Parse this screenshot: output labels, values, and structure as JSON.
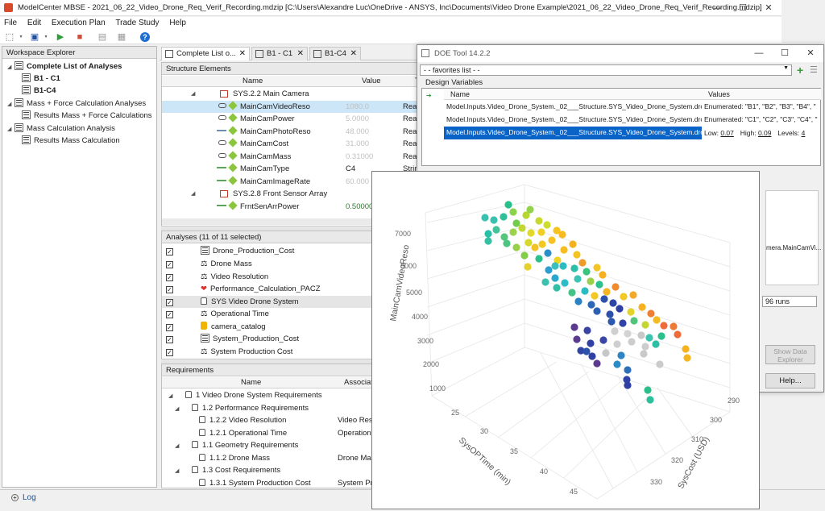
{
  "main_window": {
    "title": "ModelCenter MBSE - 2021_06_22_Video_Drone_Req_Verif_Recording.mdzip [C:\\Users\\Alexandre Luc\\OneDrive - ANSYS, Inc\\Documents\\Video Drone Example\\2021_06_22_Video_Drone_Req_Verif_Recording.mdzip]",
    "menu": [
      "File",
      "Edit",
      "Execution Plan",
      "Trade Study",
      "Help"
    ]
  },
  "workspace": {
    "header": "Workspace Explorer",
    "items": [
      {
        "label": "Complete List of Analyses",
        "bold": true
      },
      {
        "label": "B1 - C1",
        "bold": true
      },
      {
        "label": "B1-C4",
        "bold": true
      },
      {
        "label": "Mass + Force Calculation Analyses"
      },
      {
        "label": "Results Mass + Force Calculations"
      },
      {
        "label": "Mass Calculation Analysis"
      },
      {
        "label": "Results Mass Calculation"
      }
    ]
  },
  "tabs": [
    {
      "label": "Complete List o..."
    },
    {
      "label": "B1 - C1"
    },
    {
      "label": "B1-C4"
    }
  ],
  "structure": {
    "header": "Structure Elements",
    "columns": [
      "Name",
      "Value",
      "T"
    ],
    "rows": [
      {
        "name": "SYS.2.2 Main Camera",
        "value": "",
        "type": ""
      },
      {
        "name": "MainCamVideoReso",
        "value": "1080.0",
        "type": "Real"
      },
      {
        "name": "MainCamPower",
        "value": "5.0000",
        "type": "Real"
      },
      {
        "name": "MainCamPhotoReso",
        "value": "48.000",
        "type": "Real"
      },
      {
        "name": "MainCamCost",
        "value": "31.000",
        "type": "Real"
      },
      {
        "name": "MainCamMass",
        "value": "0.31000",
        "type": "Real"
      },
      {
        "name": "MainCamType",
        "value": "C4",
        "type": "Strin"
      },
      {
        "name": "MainCamImageRate",
        "value": "60.000",
        "type": "Real"
      },
      {
        "name": "SYS.2.8 Front Sensor Array",
        "value": "",
        "type": ""
      },
      {
        "name": "FrntSenArrPower",
        "value": "0.50000",
        "type": ""
      }
    ]
  },
  "analyses": {
    "header": "Analyses (11 of 11 selected)",
    "items": [
      "Drone_Production_Cost",
      "Drone Mass",
      "Video Resolution",
      "Performance_Calculation_PACZ",
      "SYS Video Drone System",
      "Operational Time",
      "camera_catalog",
      "System_Production_Cost",
      "System Production Cost"
    ]
  },
  "requirements": {
    "header": "Requirements",
    "columns": [
      "Name",
      "Associat"
    ],
    "rows": [
      {
        "name": "1  Video Drone System Requirements",
        "assoc": ""
      },
      {
        "name": "1.2  Performance Requirements",
        "assoc": ""
      },
      {
        "name": "1.2.2  Video Resolution",
        "assoc": "Video Reso"
      },
      {
        "name": "1.2.1  Operational Time",
        "assoc": "Operation"
      },
      {
        "name": "1.1  Geometry Requirements",
        "assoc": ""
      },
      {
        "name": "1.1.2  Drone Mass",
        "assoc": "Drone Ma"
      },
      {
        "name": "1.3  Cost Requirements",
        "assoc": ""
      },
      {
        "name": "1.3.1  System Production Cost",
        "assoc": "System Pr"
      }
    ]
  },
  "log": {
    "label": "Log"
  },
  "doe": {
    "title": "DOE Tool 14.2.2",
    "favorites": "- - favorites list - -",
    "design_variables_label": "Design Variables",
    "columns": [
      "Name",
      "Values"
    ],
    "rows": [
      {
        "name": "Model.Inputs.Video_Drone_System._02___Structure.SYS_Video_Drone_System.drone_Sys...",
        "values": "Enumerated:  \"B1\", \"B2\", \"B3\", \"B4\", \""
      },
      {
        "name": "Model.Inputs.Video_Drone_System._02___Structure.SYS_Video_Drone_System.drone_Sys...",
        "values": "Enumerated:  \"C1\", \"C2\", \"C3\", \"C4\", \""
      },
      {
        "name": "Model.Inputs.Video_Drone_System._02___Structure.SYS_Video_Drone_System.drone_Sys",
        "values": ""
      }
    ],
    "low_label": "Low:",
    "low_value": "0.07",
    "high_label": "High:",
    "high_value": "0.09",
    "levels_label": "Levels:",
    "levels_value": "4",
    "side_text": "mera.MainCamVi...",
    "runs": "96 runs",
    "explorer_btn": "Show Data Explorer",
    "help_btn": "Help..."
  },
  "chart_data": {
    "type": "scatter",
    "xlabel": "SysOPTime (min)",
    "ylabel": "SysCost (USD)",
    "zlabel": "MainCamVideoReso",
    "x_ticks": [
      "25",
      "30",
      "35",
      "40",
      "45"
    ],
    "y_ticks": [
      "290",
      "300",
      "310",
      "320",
      "330"
    ],
    "z_ticks": [
      "1000",
      "2000",
      "3000",
      "4000",
      "5000",
      "6000",
      "7000"
    ],
    "points": [
      {
        "x": 601,
        "y": 269,
        "color": "#3bbfae"
      },
      {
        "x": 612,
        "y": 272,
        "color": "#3bbfae"
      },
      {
        "x": 630,
        "y": 253,
        "color": "#27c08a"
      },
      {
        "x": 636,
        "y": 262,
        "color": "#8bd34a"
      },
      {
        "x": 652,
        "y": 266,
        "color": "#b6d630"
      },
      {
        "x": 657,
        "y": 259,
        "color": "#93d24a"
      },
      {
        "x": 624,
        "y": 268,
        "color": "#2fc097"
      },
      {
        "x": 640,
        "y": 276,
        "color": "#71cc4e"
      },
      {
        "x": 668,
        "y": 273,
        "color": "#c9d82c"
      },
      {
        "x": 678,
        "y": 278,
        "color": "#cddc2d"
      },
      {
        "x": 605,
        "y": 289,
        "color": "#29c0a8"
      },
      {
        "x": 615,
        "y": 284,
        "color": "#42c398"
      },
      {
        "x": 625,
        "y": 293,
        "color": "#55c57b"
      },
      {
        "x": 636,
        "y": 287,
        "color": "#9bd24b"
      },
      {
        "x": 647,
        "y": 282,
        "color": "#c2d831"
      },
      {
        "x": 658,
        "y": 288,
        "color": "#e0d82b"
      },
      {
        "x": 671,
        "y": 287,
        "color": "#f2cf25"
      },
      {
        "x": 690,
        "y": 285,
        "color": "#f6c321"
      },
      {
        "x": 697,
        "y": 290,
        "color": "#f7ba20"
      },
      {
        "x": 605,
        "y": 298,
        "color": "#34c1a3"
      },
      {
        "x": 628,
        "y": 301,
        "color": "#4ec481"
      },
      {
        "x": 640,
        "y": 306,
        "color": "#97d04a"
      },
      {
        "x": 655,
        "y": 300,
        "color": "#d6d82c"
      },
      {
        "x": 672,
        "y": 302,
        "color": "#f3c823"
      },
      {
        "x": 684,
        "y": 297,
        "color": "#f6c121"
      },
      {
        "x": 710,
        "y": 302,
        "color": "#f5b21f"
      },
      {
        "x": 650,
        "y": 316,
        "color": "#82ce4a"
      },
      {
        "x": 668,
        "y": 320,
        "color": "#2bbf8c"
      },
      {
        "x": 679,
        "y": 313,
        "color": "#2a8fc6"
      },
      {
        "x": 691,
        "y": 322,
        "color": "#ecd325"
      },
      {
        "x": 699,
        "y": 309,
        "color": "#f7bc20"
      },
      {
        "x": 715,
        "y": 315,
        "color": "#f3c423"
      },
      {
        "x": 722,
        "y": 325,
        "color": "#ed9b2b"
      },
      {
        "x": 654,
        "y": 330,
        "color": "#e4d12a"
      },
      {
        "x": 680,
        "y": 334,
        "color": "#2c9fd0"
      },
      {
        "x": 698,
        "y": 329,
        "color": "#2bbcc3"
      },
      {
        "x": 712,
        "y": 332,
        "color": "#2bbfa8"
      },
      {
        "x": 727,
        "y": 336,
        "color": "#3ac27e"
      },
      {
        "x": 740,
        "y": 331,
        "color": "#f3c422"
      },
      {
        "x": 747,
        "y": 340,
        "color": "#f5b120"
      },
      {
        "x": 688,
        "y": 344,
        "color": "#2aa6cf"
      },
      {
        "x": 700,
        "y": 350,
        "color": "#2bbcc7"
      },
      {
        "x": 716,
        "y": 345,
        "color": "#3bc4b5"
      },
      {
        "x": 732,
        "y": 348,
        "color": "#9ad04a"
      },
      {
        "x": 743,
        "y": 352,
        "color": "#2bc08e"
      },
      {
        "x": 690,
        "y": 356,
        "color": "#31bfa6"
      },
      {
        "x": 709,
        "y": 362,
        "color": "#44c388"
      },
      {
        "x": 725,
        "y": 360,
        "color": "#2bbcc2"
      },
      {
        "x": 737,
        "y": 366,
        "color": "#f2c823"
      },
      {
        "x": 752,
        "y": 361,
        "color": "#f6b521"
      },
      {
        "x": 763,
        "y": 355,
        "color": "#ef8a2e"
      },
      {
        "x": 717,
        "y": 373,
        "color": "#2a82c2"
      },
      {
        "x": 733,
        "y": 377,
        "color": "#2b69b8"
      },
      {
        "x": 749,
        "y": 370,
        "color": "#2c4faa"
      },
      {
        "x": 760,
        "y": 375,
        "color": "#2e45a6"
      },
      {
        "x": 773,
        "y": 367,
        "color": "#f2c823"
      },
      {
        "x": 785,
        "y": 365,
        "color": "#f4a82a"
      },
      {
        "x": 740,
        "y": 385,
        "color": "#2b60b4"
      },
      {
        "x": 756,
        "y": 389,
        "color": "#2d50aa"
      },
      {
        "x": 768,
        "y": 382,
        "color": "#2e3fa4"
      },
      {
        "x": 782,
        "y": 386,
        "color": "#e3d32a"
      },
      {
        "x": 796,
        "y": 380,
        "color": "#f5b121"
      },
      {
        "x": 807,
        "y": 388,
        "color": "#ee7e34"
      },
      {
        "x": 758,
        "y": 398,
        "color": "#2c57ae"
      },
      {
        "x": 772,
        "y": 400,
        "color": "#2f42a5"
      },
      {
        "x": 786,
        "y": 397,
        "color": "#52c57d"
      },
      {
        "x": 800,
        "y": 402,
        "color": "#c5d632"
      },
      {
        "x": 814,
        "y": 396,
        "color": "#f4bc22"
      },
      {
        "x": 823,
        "y": 403,
        "color": "#ef6b3a"
      },
      {
        "x": 835,
        "y": 404,
        "color": "#ee7a36"
      },
      {
        "x": 712,
        "y": 405,
        "color": "#5a3b8e"
      },
      {
        "x": 728,
        "y": 409,
        "color": "#3a44a3"
      },
      {
        "x": 762,
        "y": 410,
        "color": "#cfcfcf"
      },
      {
        "x": 778,
        "y": 413,
        "color": "#d3d3d3"
      },
      {
        "x": 795,
        "y": 415,
        "color": "#c8c8c8"
      },
      {
        "x": 805,
        "y": 418,
        "color": "#3bc4b0"
      },
      {
        "x": 820,
        "y": 416,
        "color": "#2bbf8c"
      },
      {
        "x": 840,
        "y": 414,
        "color": "#ef6b3a"
      },
      {
        "x": 715,
        "y": 420,
        "color": "#5a3b8e"
      },
      {
        "x": 732,
        "y": 425,
        "color": "#2f3fa4"
      },
      {
        "x": 748,
        "y": 421,
        "color": "#3a46a6"
      },
      {
        "x": 765,
        "y": 426,
        "color": "#cfcfcf"
      },
      {
        "x": 783,
        "y": 423,
        "color": "#cdcdcd"
      },
      {
        "x": 800,
        "y": 429,
        "color": "#cdcdcd"
      },
      {
        "x": 813,
        "y": 426,
        "color": "#2bbfa6"
      },
      {
        "x": 850,
        "y": 432,
        "color": "#f6b020"
      },
      {
        "x": 720,
        "y": 434,
        "color": "#3145a7"
      },
      {
        "x": 734,
        "y": 441,
        "color": "#2f40a5"
      },
      {
        "x": 751,
        "y": 437,
        "color": "#c7c7c7"
      },
      {
        "x": 770,
        "y": 440,
        "color": "#2c84c4"
      },
      {
        "x": 798,
        "y": 438,
        "color": "#c9c9c9"
      },
      {
        "x": 852,
        "y": 443,
        "color": "#f5b521"
      },
      {
        "x": 740,
        "y": 450,
        "color": "#5b3a8f"
      },
      {
        "x": 765,
        "y": 451,
        "color": "#2b8cc6"
      },
      {
        "x": 818,
        "y": 451,
        "color": "#cbcbcb"
      },
      {
        "x": 778,
        "y": 458,
        "color": "#2d6fb9"
      },
      {
        "x": 777,
        "y": 470,
        "color": "#2f42a5"
      },
      {
        "x": 778,
        "y": 477,
        "color": "#2e3fa4"
      },
      {
        "x": 803,
        "y": 483,
        "color": "#2bbf8c"
      },
      {
        "x": 806,
        "y": 495,
        "color": "#2bbf9b"
      },
      {
        "x": 727,
        "y": 435,
        "color": "#2c52ad"
      },
      {
        "x": 688,
        "y": 329,
        "color": "#3bbfbf"
      },
      {
        "x": 663,
        "y": 306,
        "color": "#f2c322"
      },
      {
        "x": 676,
        "y": 349,
        "color": "#3bbfae"
      }
    ]
  }
}
